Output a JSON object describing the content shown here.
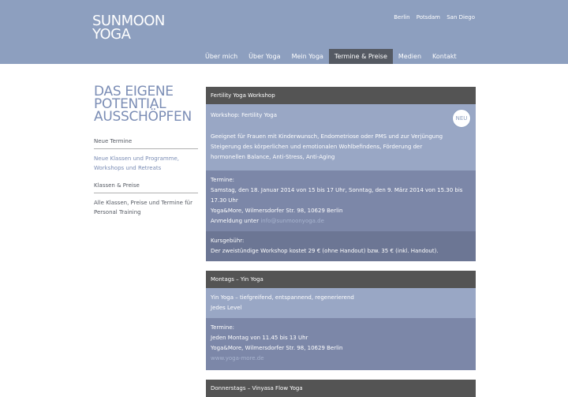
{
  "logo": {
    "line1": "SUNMOON",
    "line2": "YOGA"
  },
  "cities": [
    "Berlin",
    "Potsdam",
    "San Diego"
  ],
  "nav": [
    "Über mich",
    "Über Yoga",
    "Mein Yoga",
    "Termine & Preise",
    "Medien",
    "Kontakt"
  ],
  "nav_active": "Termine & Preise",
  "colors": {
    "header": "#8d9fbf",
    "accent": "#7b8db5",
    "dark": "#545454"
  },
  "left": {
    "headline": [
      "DAS EIGENE",
      "POTENTIAL",
      "AUSSCHÖPFEN"
    ],
    "sections": [
      {
        "title": "Neue Termine",
        "link": [
          "Neue Klassen und Programme,",
          "Workshops und Retreats"
        ]
      },
      {
        "title": "Klassen & Preise",
        "text": [
          "Alle Klassen, Preise und Termine für",
          "Personal Training"
        ]
      }
    ]
  },
  "cards": [
    {
      "title": "Fertility Yoga Workshop",
      "badge": "NEU",
      "desc_title": "Workshop: Fertility Yoga",
      "desc": "Geeignet für Frauen mit Kinderwunsch, Endometriose oder PMS und zur Verjüngung Steigerung des körperlichen und emotionalen Wohlbefindens, Förderung der hormonellen Balance, Anti-Stress, Anti-Aging",
      "termine_label": "Termine:",
      "termine": "Samstag, den 18. Januar 2014 von 15 bis 17 Uhr, Sonntag, den 9. März 2014 von 15.30 bis 17.30 Uhr",
      "location": "Yoga&More, Wilmersdorfer Str. 98, 10629 Berlin",
      "anmeldung_label": "Anmeldung unter",
      "anmeldung_link": "info@sunmoonyoga.de",
      "fee_label": "Kursgebühr:",
      "fee": "Der zweistündige Workshop kostet 29 € (ohne Handout) bzw. 35 € (inkl. Handout)."
    },
    {
      "title": "Montags – Yin Yoga",
      "desc": "Yin Yoga – tiefgreifend, entspannend, regenerierend",
      "level": "Jedes Level",
      "termine_label": "Termine:",
      "termine": "Jeden Montag von 11.45 bis 13 Uhr",
      "location": "Yoga&More, Wilmersdorfer Str. 98, 10629 Berlin",
      "link": "www.yoga-more.de"
    },
    {
      "title": "Donnerstags – Vinyasa Flow Yoga"
    }
  ]
}
